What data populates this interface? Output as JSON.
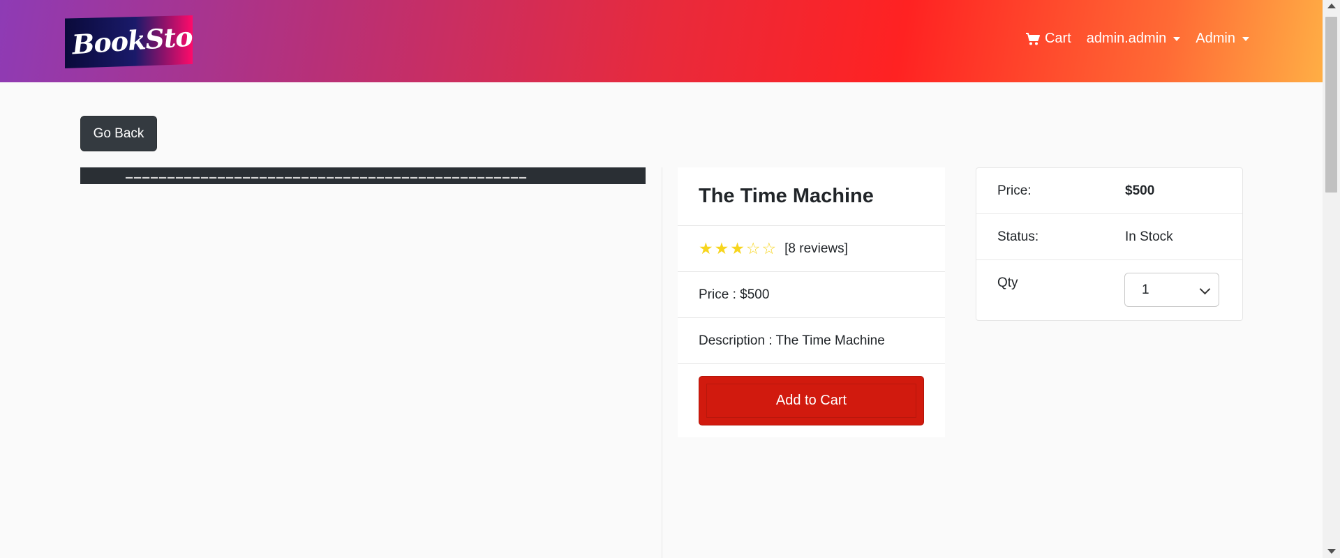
{
  "brand": {
    "logo_text": "BookStore"
  },
  "nav": {
    "cart_label": "Cart",
    "user_label": "admin.admin",
    "admin_label": "Admin"
  },
  "actions": {
    "go_back_label": "Go Back"
  },
  "product": {
    "title": "The Time Machine",
    "rating": 3,
    "rating_max": 5,
    "reviews_label": "[8 reviews]",
    "price_line": "Price : $500",
    "description_line": "Description : The Time Machine",
    "add_to_cart_label": "Add to Cart"
  },
  "summary": {
    "price_label": "Price:",
    "price_value": "$500",
    "status_label": "Status:",
    "status_value": "In Stock",
    "qty_label": "Qty",
    "qty_value": "1"
  },
  "colors": {
    "add_to_cart": "#d11a0e",
    "go_back": "#343a40",
    "star": "#f7d51d"
  }
}
